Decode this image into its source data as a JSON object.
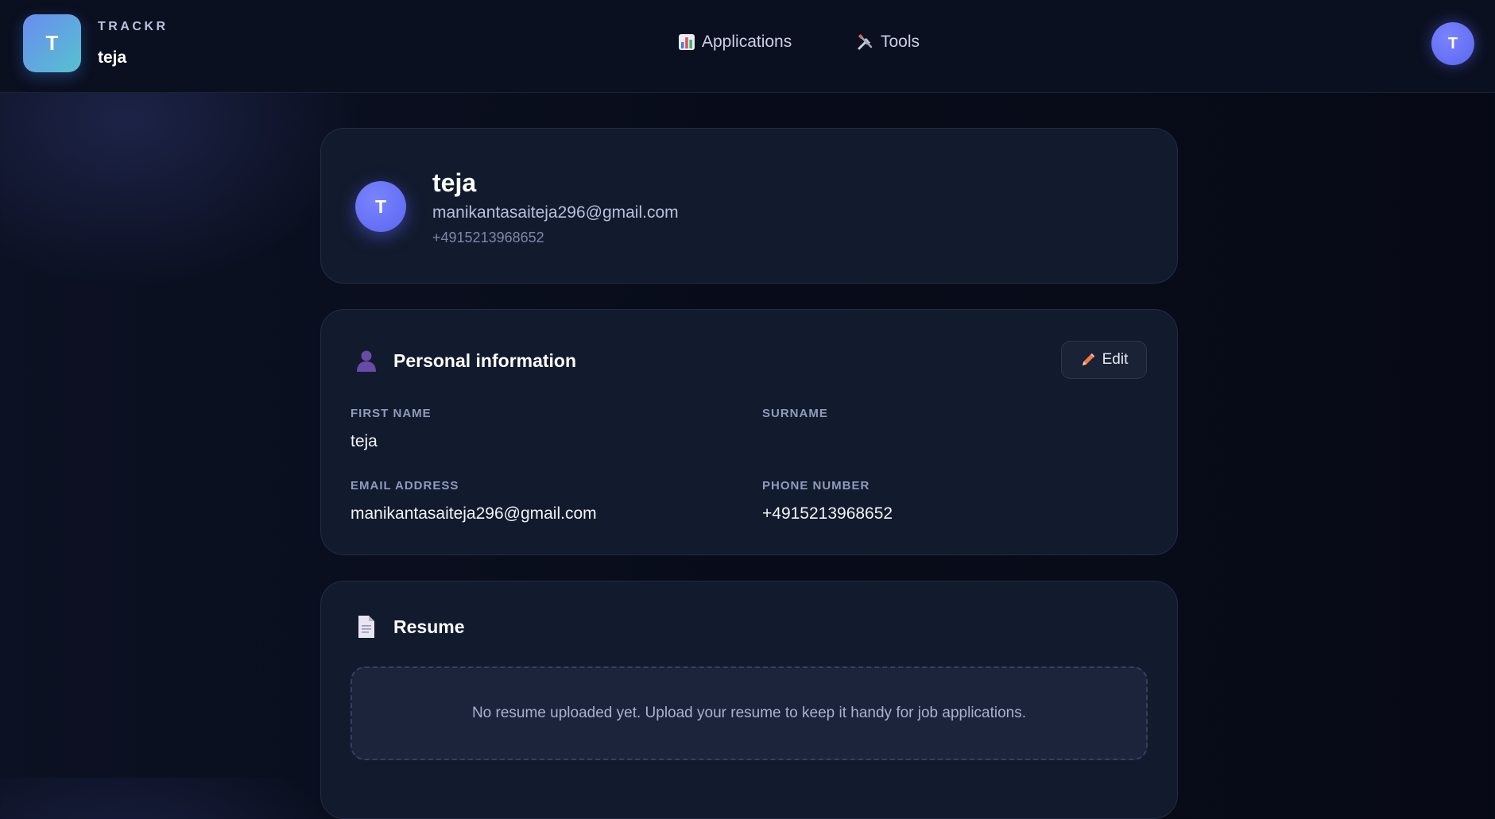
{
  "brand": {
    "logo_letter": "T",
    "name": "TRACKR",
    "user": "teja"
  },
  "nav": {
    "applications": {
      "label": "Applications",
      "icon": "bar-chart-icon"
    },
    "tools": {
      "label": "Tools",
      "icon": "tools-icon"
    }
  },
  "account": {
    "avatar_letter": "T"
  },
  "profile": {
    "avatar_letter": "T",
    "name": "teja",
    "email": "manikantasaiteja296@gmail.com",
    "phone": "+4915213968652"
  },
  "personal": {
    "title": "Personal information",
    "icon": "user-icon",
    "edit_label": "Edit",
    "fields": {
      "first_name": {
        "label": "FIRST NAME",
        "value": "teja"
      },
      "surname": {
        "label": "SURNAME",
        "value": ""
      },
      "email": {
        "label": "EMAIL ADDRESS",
        "value": "manikantasaiteja296@gmail.com"
      },
      "phone": {
        "label": "PHONE NUMBER",
        "value": "+4915213968652"
      }
    }
  },
  "resume": {
    "title": "Resume",
    "icon": "document-icon",
    "empty_text": "No resume uploaded yet. Upload your resume to keep it handy for job applications."
  },
  "colors": {
    "accent": "#6a73ff",
    "background": "#080c1a",
    "card": "#121a2d",
    "edit_icon": "#f07a4a"
  }
}
